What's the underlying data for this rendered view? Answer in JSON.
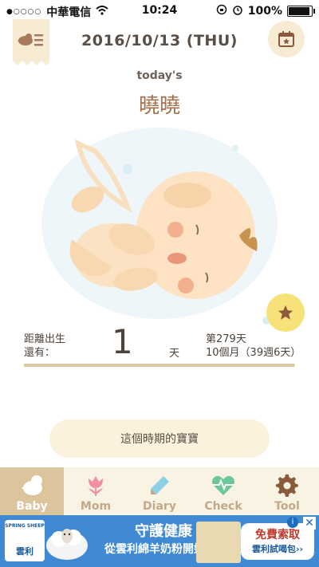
{
  "status_bar": {
    "carrier": "中華電信",
    "time": "10:24",
    "battery": "100%"
  },
  "header": {
    "date": "2016/10/13 (THU)"
  },
  "today": {
    "label": "today's",
    "name": "曉曉"
  },
  "countdown": {
    "label_line1": "距離出生",
    "label_line2": "還有：",
    "days": "1",
    "unit": "天",
    "week_line1": "第279天",
    "week_line2": "10個月（39週6天）",
    "progress": 0.996
  },
  "period_button": "這個時期的寶寶",
  "tabs": [
    {
      "label": "Baby",
      "active": true
    },
    {
      "label": "Mom",
      "active": false
    },
    {
      "label": "Diary",
      "active": false
    },
    {
      "label": "Check",
      "active": false
    },
    {
      "label": "Tool",
      "active": false
    }
  ],
  "ad": {
    "brand": "SPRING SHEEP",
    "brand_sub": "雲利",
    "headline": "守護健康",
    "subline": "從雲利綿羊奶粉開始",
    "cta1": "免費索取",
    "cta2": "雲利試喝包››",
    "info": "i",
    "close": "✕"
  },
  "colors": {
    "accent": "#a4704b",
    "tab_active": "#dcc49c",
    "tab_bar": "#f8f3e3",
    "star": "#f7e27a",
    "ad_bg": "#3f8ad3"
  }
}
